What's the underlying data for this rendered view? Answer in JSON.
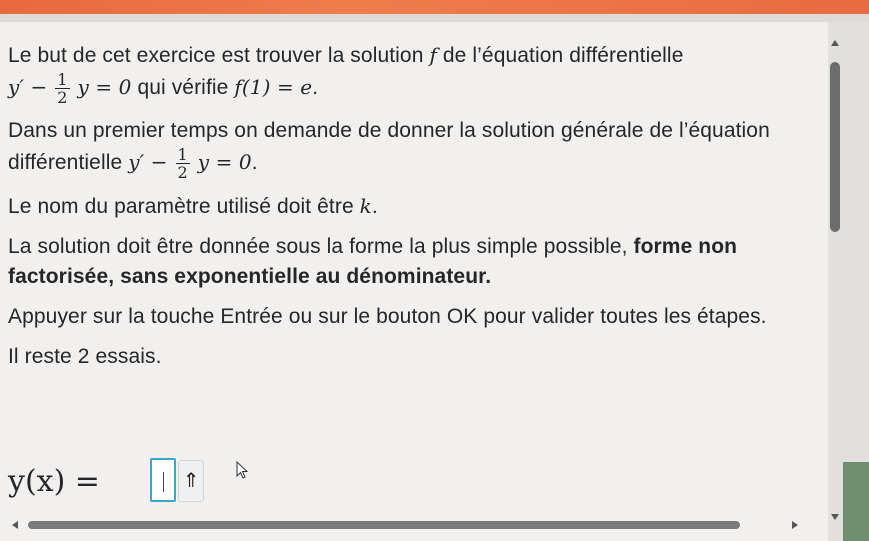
{
  "exercise": {
    "p1_a": "Le but de cet exercice est trouver la solution ",
    "p1_f": "f",
    "p1_b": " de l’équation différentielle",
    "p1_eq_y": "y′ −",
    "p1_eq_num": "1",
    "p1_eq_den": "2",
    "p1_eq_tail": "y = 0",
    "p1_c": " qui vérifie ",
    "p1_cond": "f(1) = e",
    "p1_end": ".",
    "p2_a": "Dans un premier temps on demande de donner la solution générale de l’équation différentielle ",
    "p2_eq_y": "y′ −",
    "p2_eq_num": "1",
    "p2_eq_den": "2",
    "p2_eq_tail": "y = 0",
    "p2_end": ".",
    "p3_a": "Le nom du paramètre utilisé doit être ",
    "p3_k": "k",
    "p3_end": ".",
    "p4_a": "La solution doit être donnée sous la forme la plus simple possible, ",
    "p4_bold": "forme non factorisée, sans exponentielle au dénominateur.",
    "p5": "Appuyer sur la touche Entrée ou sur le bouton OK pour valider toutes les étapes.",
    "p6": "Il reste 2 essais."
  },
  "answer": {
    "label": "y(x) =",
    "value": "",
    "shift_label": "⇑"
  },
  "colors": {
    "accent": "#38a8c9",
    "top_strip": "#ef7446"
  }
}
